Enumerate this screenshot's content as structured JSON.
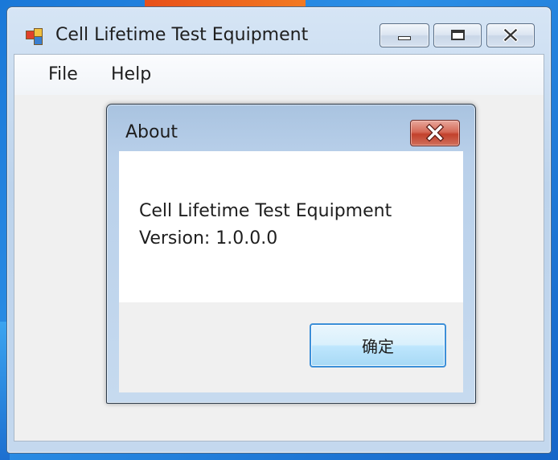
{
  "main_window": {
    "title": "Cell Lifetime Test Equipment",
    "icon": "application-icon",
    "caption_buttons": [
      "minimize-icon",
      "maximize-icon",
      "close-icon"
    ]
  },
  "menu": {
    "items": [
      {
        "label": "File"
      },
      {
        "label": "Help"
      }
    ]
  },
  "about_dialog": {
    "title": "About",
    "close_icon": "close-icon",
    "product_name": "Cell Lifetime Test Equipment",
    "version": "Version: 1.0.0.0",
    "ok_label": "确定"
  },
  "colors": {
    "client_background": "#f0f0f0",
    "dialog_close_button": "#c94a36",
    "ok_button_border": "#3c8fd8"
  }
}
